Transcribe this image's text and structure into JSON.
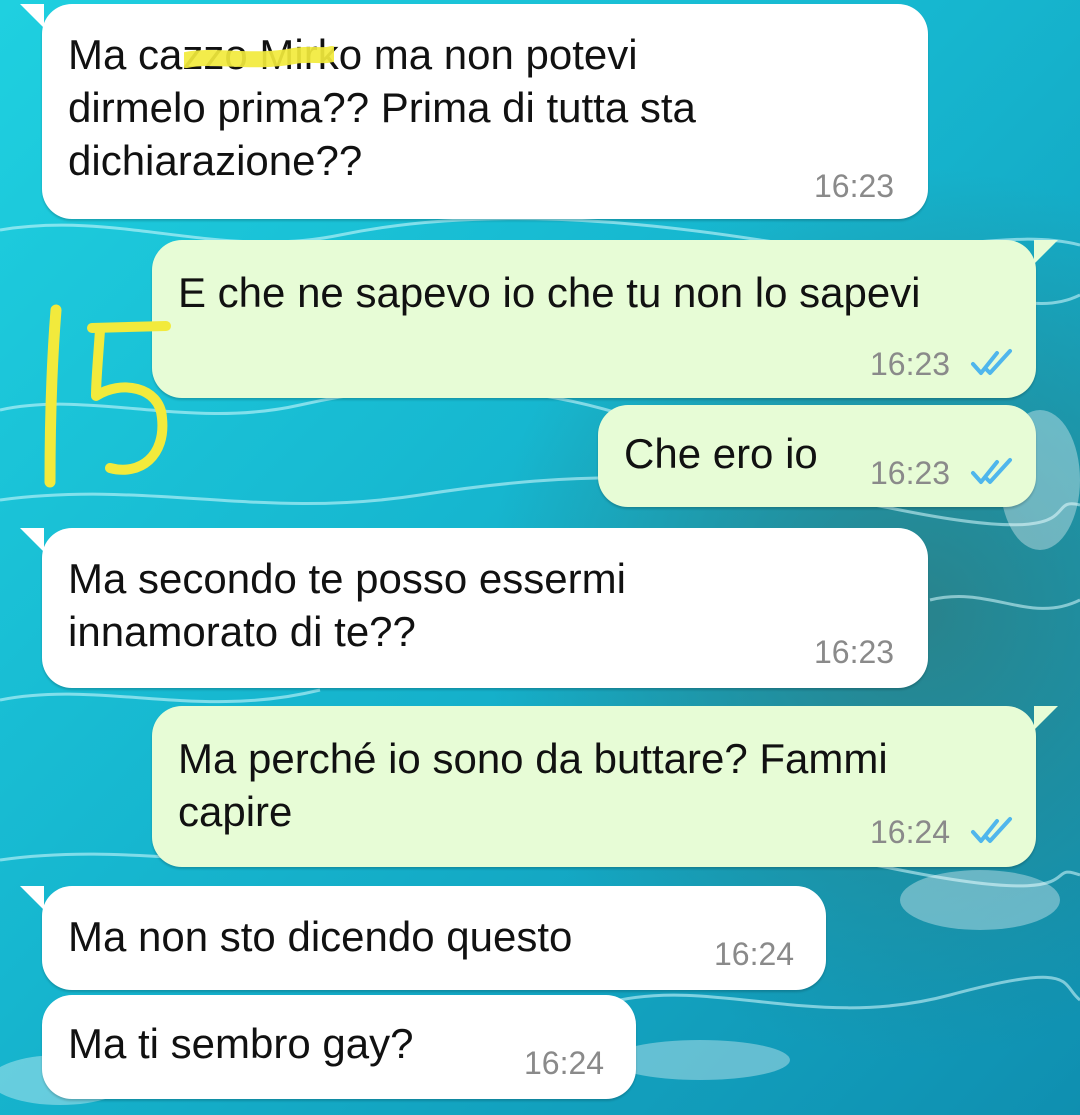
{
  "colors": {
    "incoming_bubble": "#ffffff",
    "outgoing_bubble": "#e7fcd6",
    "read_ticks": "#4fb6ec",
    "timestamp": "#8a8a8a",
    "highlighter": "#f2ea3c",
    "wallpaper": "#19c2d6"
  },
  "annotation": {
    "handwritten_number": "15"
  },
  "messages": [
    {
      "direction": "incoming",
      "text": "Ma cazzo Mirko ma non potevi\ndirmelo prima?? Prima di tutta sta\ndichiarazione??",
      "time": "16:23",
      "redacted_word": "cazzo"
    },
    {
      "direction": "outgoing",
      "text": "E che ne sapevo io che tu non lo sapevi",
      "time": "16:23",
      "status_icon": "double-check-icon"
    },
    {
      "direction": "outgoing",
      "text": "Che ero io",
      "time": "16:23",
      "status_icon": "double-check-icon"
    },
    {
      "direction": "incoming",
      "text": "Ma secondo te posso essermi\ninnamorato di te??",
      "time": "16:23"
    },
    {
      "direction": "outgoing",
      "text": "Ma perché io sono da buttare? Fammi\ncapire",
      "time": "16:24",
      "status_icon": "double-check-icon"
    },
    {
      "direction": "incoming",
      "text": "Ma non sto dicendo questo",
      "time": "16:24"
    },
    {
      "direction": "incoming",
      "text": "Ma ti sembro gay?",
      "time": "16:24"
    }
  ]
}
